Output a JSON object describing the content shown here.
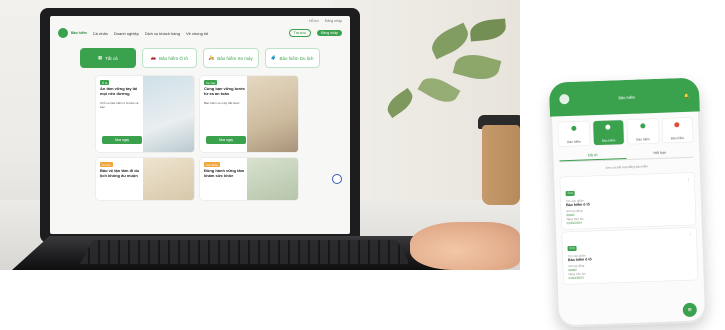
{
  "laptop_site": {
    "topbar": [
      "Hỗ trợ",
      "Đăng nhập"
    ],
    "brand": "Bảo hiểm",
    "nav": [
      "Cá nhân",
      "Doanh nghiệp",
      "Dịch vụ khách hàng",
      "Về chúng tôi"
    ],
    "nav_buttons": {
      "outline": "Tra cứu",
      "fill": "Đăng nhập"
    },
    "tabs": [
      {
        "label": "Tất cả",
        "active": true
      },
      {
        "label": "Bảo hiểm Ô tô",
        "active": false
      },
      {
        "label": "Bảo hiểm Xe máy",
        "active": false
      },
      {
        "label": "Bảo hiểm Du lịch",
        "active": false
      }
    ],
    "cards": [
      {
        "badge": "Ô tô",
        "badge_color": "green",
        "title": "An tâm vững tay lái mọi nẻo đường",
        "desc": "Chủ xe bảo hiểm ô tô bảo vệ bạn",
        "button": "Mua ngay",
        "photo_color": "#cfe0e8"
      },
      {
        "badge": "Xe máy",
        "badge_color": "green",
        "title": "Cùng bạn vững bước từ xa an toàn",
        "desc": "Bảo hiểm xe máy bắt buộc",
        "button": "Mua ngay",
        "photo_color": "#d9cbb5"
      },
      {
        "badge": "Du lịch",
        "badge_color": "orange",
        "title": "Bảo vệ tận tâm đi du lịch không âu muộn",
        "desc": "",
        "button": "",
        "photo_color": "#e7dcc6"
      },
      {
        "badge": "Sức khỏe",
        "badge_color": "orange",
        "title": "Đồng hành vững tâm khám sức khỏe",
        "desc": "",
        "button": "",
        "photo_color": "#cfd8c7"
      }
    ]
  },
  "phone_app": {
    "header_title": "Bảo hiểm",
    "quick_actions": [
      {
        "label": "Bảo hiểm",
        "dot": "green",
        "active": false
      },
      {
        "label": "Bảo hiểm",
        "dot": "green",
        "active": true
      },
      {
        "label": "Bảo hiểm",
        "dot": "green",
        "active": false
      },
      {
        "label": "Bảo hiểm",
        "dot": "red",
        "active": false
      }
    ],
    "segments": [
      {
        "label": "Đã có",
        "on": true
      },
      {
        "label": "Hết hạn",
        "on": false
      }
    ],
    "hint": "Xem chi tiết hợp đồng bảo hiểm",
    "policies": [
      {
        "tag": "Ô tô",
        "label_name": "Tên sản phẩm",
        "name": "Bảo hiểm ô tô",
        "label_code": "Số hợp đồng",
        "code": "00001",
        "label_date": "Ngày hiệu lực",
        "date": "01/01/2024"
      },
      {
        "tag": "Ô tô",
        "label_name": "Tên sản phẩm",
        "name": "Bảo hiểm ô tô",
        "label_code": "Số hợp đồng",
        "code": "00002",
        "label_date": "Ngày hiệu lực",
        "date": "01/01/2024"
      }
    ],
    "fab": "≡"
  },
  "colors": {
    "brand_green": "#3aa14d",
    "accent_orange": "#f0a63a"
  }
}
